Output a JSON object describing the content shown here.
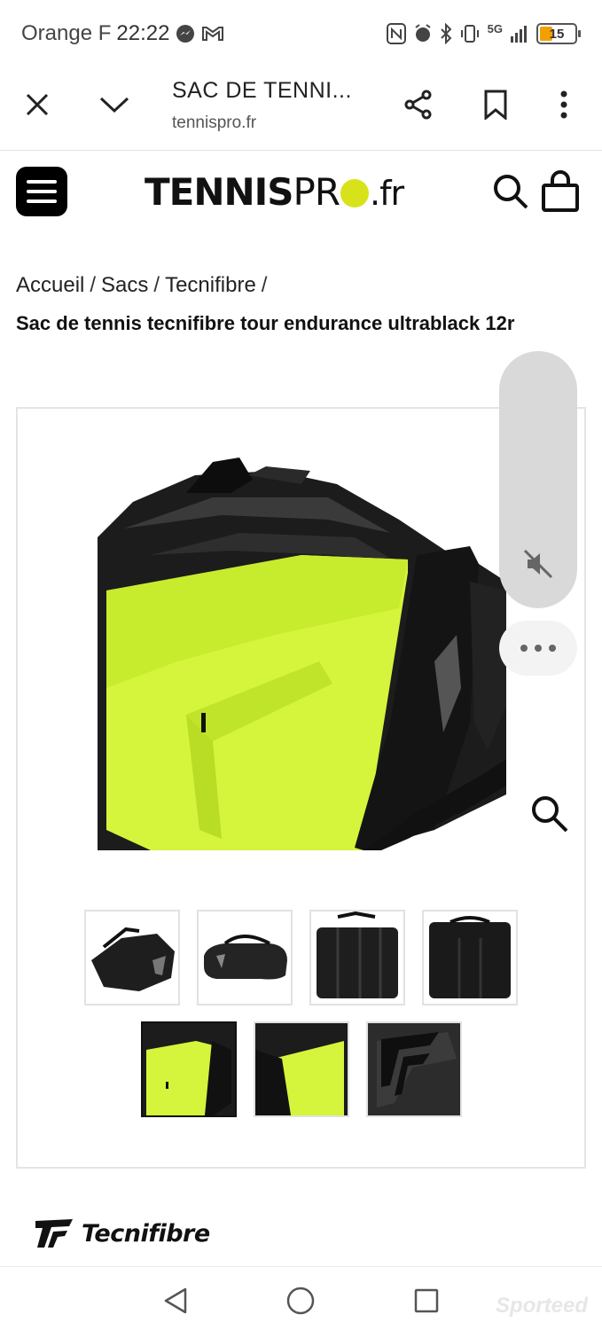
{
  "status_bar": {
    "carrier": "Orange F",
    "time": "22:22",
    "network": "5G",
    "battery": "15",
    "battery_color": "#f0a000"
  },
  "browser": {
    "title": "SAC DE TENNI...",
    "url": "tennispro.fr",
    "icons": [
      "close-icon",
      "chevron-down-icon",
      "share-icon",
      "bookmark-icon",
      "more-vertical-icon"
    ]
  },
  "site": {
    "logo_text_bold": "TENNIS",
    "logo_text_pro": "PR",
    "logo_text_tld": ".fr",
    "logo_ball_color": "#d8e21a",
    "icons": [
      "menu-icon",
      "search-icon",
      "shopping-bag-icon"
    ]
  },
  "breadcrumb": {
    "items": [
      "Accueil",
      "Sacs",
      "Tecnifibre"
    ],
    "separator": "/"
  },
  "product": {
    "title": "Sac de tennis tecnifibre tour endurance ultrablack 12r",
    "accent_color": "#d4f53c"
  },
  "gallery": {
    "thumbnails": [
      "bag-side-view",
      "bag-front-view",
      "bag-open-top-view",
      "bag-back-view",
      "bag-open-interior-view",
      "bag-interior-angle-view",
      "bag-logo-detail"
    ],
    "active_index": 4
  },
  "brand": {
    "name": "Tecnifibre"
  },
  "watermark": "Sporteed"
}
